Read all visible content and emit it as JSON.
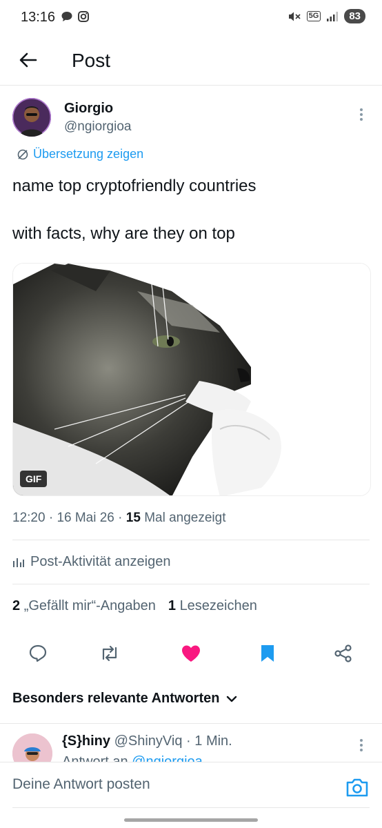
{
  "status_bar": {
    "time": "13:16",
    "network": "5G",
    "battery": "83"
  },
  "header": {
    "title": "Post"
  },
  "post": {
    "author_name": "Giorgio",
    "author_handle": "@ngiorgioa",
    "translate_label": "Übersetzung zeigen",
    "text_line1": "name top cryptofriendly countries",
    "text_line2": "with facts, why are they on top",
    "media_badge": "GIF",
    "time": "12:20",
    "date": "16 Mai 26",
    "views_count": "15",
    "views_label": "Mal angezeigt",
    "activity_label": "Post-Aktivität anzeigen",
    "likes_count": "2",
    "likes_label": "„Gefällt mir“-Angaben",
    "bookmarks_count": "1",
    "bookmarks_label": "Lesezeichen"
  },
  "replies": {
    "sort_label": "Besonders relevante Antworten",
    "first_reply": {
      "name": "{S}hiny",
      "handle": "@ShinyViq",
      "time": "1 Min.",
      "reply_to_prefix": "Antwort an",
      "reply_to_handle": "@ngiorgioa"
    }
  },
  "composer": {
    "placeholder": "Deine Antwort posten"
  },
  "icons": {
    "back": "arrow-left-icon",
    "more": "more-vertical-icon",
    "translate": "translate-icon",
    "activity": "bar-chart-icon",
    "reply": "reply-icon",
    "repost": "repost-icon",
    "like": "heart-icon",
    "bookmark": "bookmark-icon",
    "share": "share-icon",
    "chevron": "chevron-down-icon",
    "camera": "camera-icon"
  },
  "colors": {
    "accent": "#1d9bf0",
    "like": "#f91880",
    "text": "#0f1419",
    "secondary": "#536471"
  }
}
